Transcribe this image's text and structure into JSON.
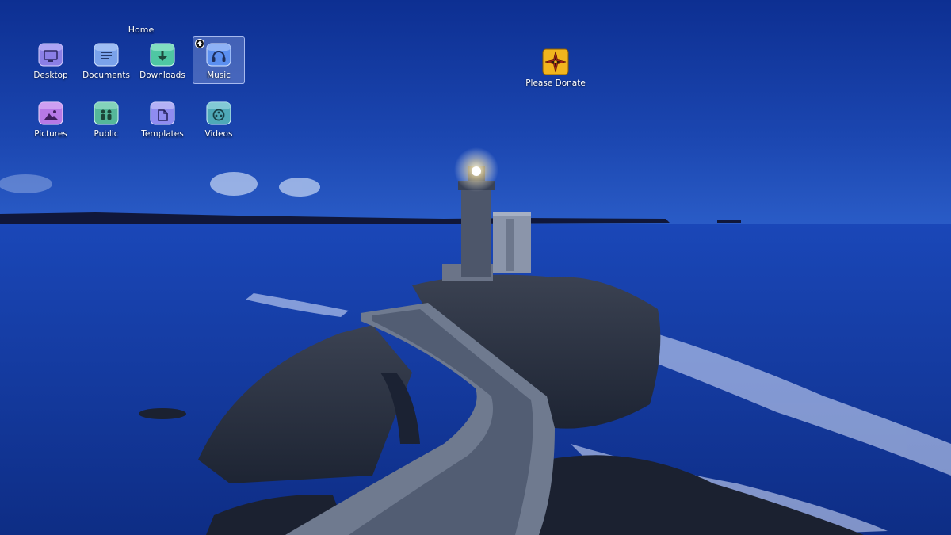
{
  "desktop": {
    "path_label": "Home",
    "icons": [
      {
        "id": "desktop",
        "label": "Desktop",
        "symbol": "desktop-icon",
        "color": "#8b7fe6"
      },
      {
        "id": "documents",
        "label": "Documents",
        "symbol": "document-icon",
        "color": "#7aa2ea"
      },
      {
        "id": "downloads",
        "label": "Downloads",
        "symbol": "download-icon",
        "color": "#4fc7a3"
      },
      {
        "id": "music",
        "label": "Music",
        "symbol": "music-icon",
        "color": "#5b8ff0",
        "selected": true
      },
      {
        "id": "pictures",
        "label": "Pictures",
        "symbol": "image-icon",
        "color": "#b779e6"
      },
      {
        "id": "public",
        "label": "Public",
        "symbol": "people-icon",
        "color": "#55b89a"
      },
      {
        "id": "templates",
        "label": "Templates",
        "symbol": "template-icon",
        "color": "#8f8cf0"
      },
      {
        "id": "videos",
        "label": "Videos",
        "symbol": "video-reel-icon",
        "color": "#4fa9b8"
      }
    ],
    "donate": {
      "label": "Please Donate",
      "symbol": "compass-star-icon",
      "color": "#f2b51e"
    }
  },
  "wallpaper": {
    "sky": "#173fa6",
    "sea": "#1a46b3"
  }
}
